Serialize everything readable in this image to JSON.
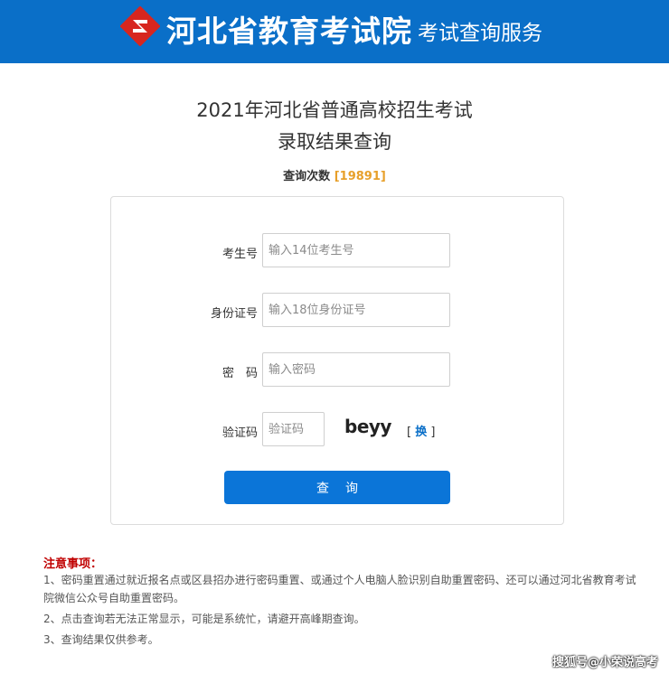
{
  "header": {
    "org_name": "河北省教育考试院",
    "service_name": "考试查询服务",
    "brand_color": "#0a6fc8"
  },
  "title": {
    "line1": "2021年河北省普通高校招生考试",
    "line2": "录取结果查询"
  },
  "counter": {
    "label": "查询次数",
    "open": "[",
    "value": "19891",
    "close": "]"
  },
  "form": {
    "exam_no_label": "考生号",
    "exam_no_placeholder": "输入14位考生号",
    "id_label": "身份证号",
    "id_placeholder": "输入18位身份证号",
    "password_label": "密　码",
    "password_placeholder": "输入密码",
    "captcha_label": "验证码",
    "captcha_placeholder": "验证码",
    "captcha_text": "beyy",
    "refresh_open": "[",
    "refresh_label": "换",
    "refresh_close": "]",
    "submit_label": "查询"
  },
  "notes": {
    "title": "注意事项：",
    "item1": "1、密码重置通过就近报名点或区县招办进行密码重置、或通过个人电脑人脸识别自助重置密码、还可以通过河北省教育考试院微信公众号自助重置密码。",
    "item2": "2、点击查询若无法正常显示，可能是系统忙，请避开高峰期查询。",
    "item3": "3、查询结果仅供参考。"
  },
  "watermark": "搜狐号@小荣说高考"
}
